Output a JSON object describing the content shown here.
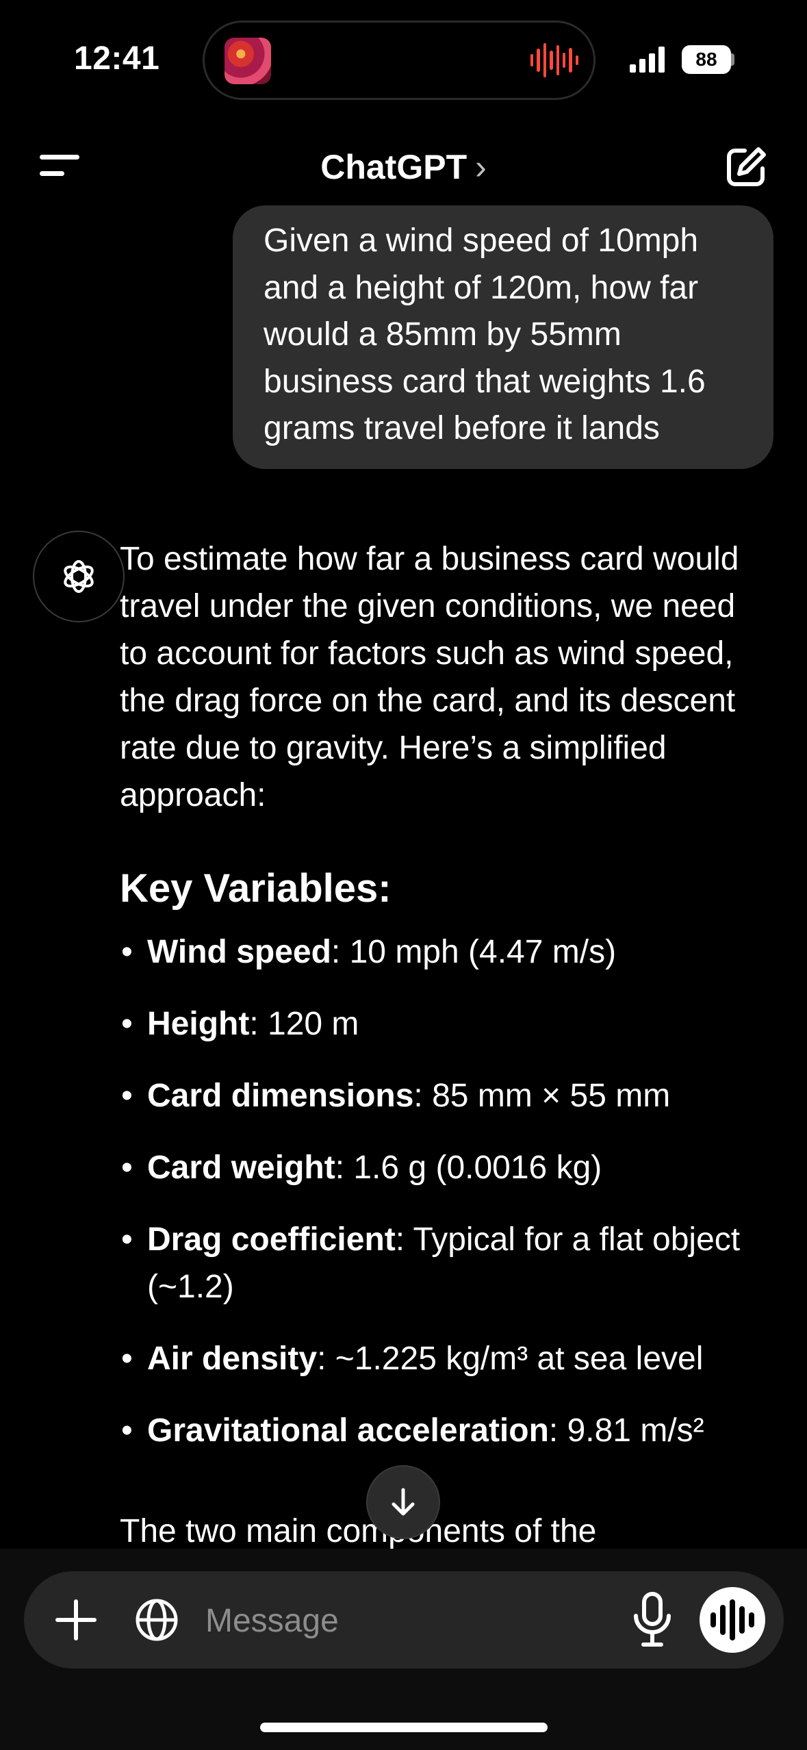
{
  "status_bar": {
    "time": "12:41",
    "battery": "88",
    "audio_indicator_color": "#ff4a3d"
  },
  "nav": {
    "title": "ChatGPT",
    "title_chevron": "›",
    "menu_icon": "menu-icon",
    "compose_icon": "compose-icon"
  },
  "user_message": "Given a wind speed of 10mph and a height of 120m, how far would a 85mm by 55mm business card that weights 1.6 grams travel before it lands",
  "assistant": {
    "intro": "To estimate how far a business card would travel under the given conditions, we need to account for factors such as wind speed, the drag force on the card, and its descent rate due to gravity. Here’s a simplified approach:",
    "heading": "Key Variables:",
    "variables": [
      {
        "term": "Wind speed",
        "desc": ": 10 mph (4.47 m/s)"
      },
      {
        "term": "Height",
        "desc": ": 120 m"
      },
      {
        "term": "Card dimensions",
        "desc": ": 85 mm × 55 mm"
      },
      {
        "term": "Card weight",
        "desc": ": 1.6 g (0.0016 kg)"
      },
      {
        "term": "Drag coefficient",
        "desc": ": Typical for a flat object (~1.2)"
      },
      {
        "term": "Air density",
        "desc": ": ~1.225 kg/m³ at sea level"
      },
      {
        "term": "Gravitational acceleration",
        "desc": ": 9.81 m/s²"
      }
    ],
    "continuation": "The two main components of the"
  },
  "composer": {
    "placeholder": "Message"
  },
  "colors": {
    "background": "#000000",
    "user_bubble": "#2f2f2f",
    "composer": "#262626"
  }
}
